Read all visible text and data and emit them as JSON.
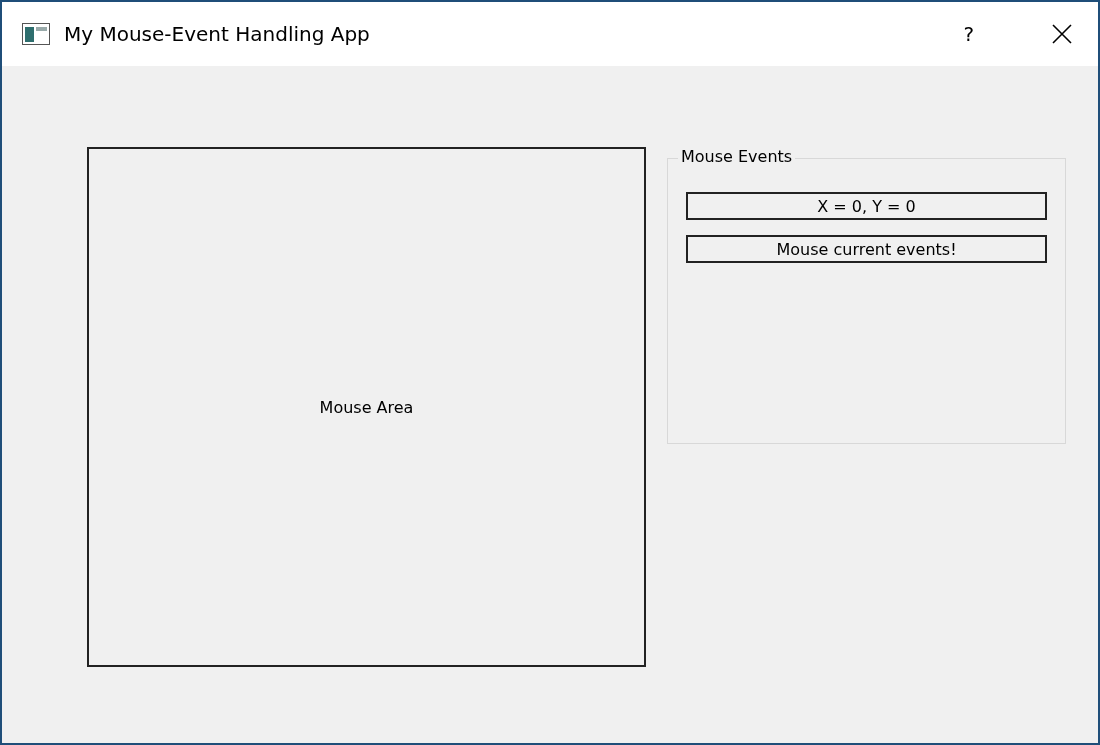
{
  "window": {
    "title": "My Mouse-Event Handling App",
    "help": "?"
  },
  "mouse_area": {
    "label": "Mouse Area"
  },
  "group": {
    "title": "Mouse Events",
    "labels": [
      "X = 0, Y = 0",
      "Mouse current events!"
    ]
  }
}
